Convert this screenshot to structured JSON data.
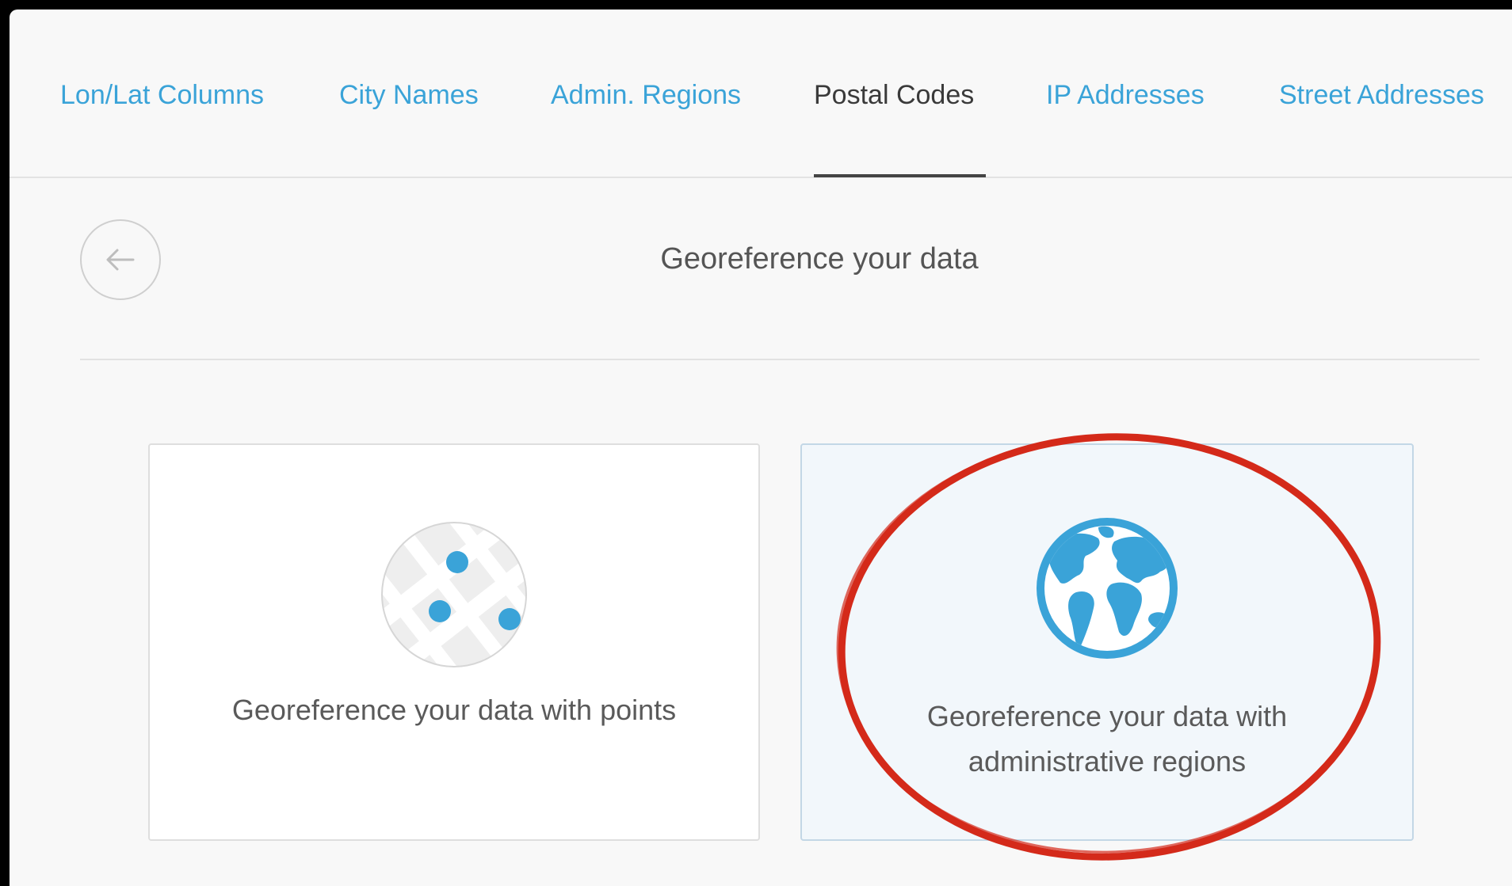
{
  "tabs": [
    {
      "label": "Lon/Lat Columns",
      "active": false
    },
    {
      "label": "City Names",
      "active": false
    },
    {
      "label": "Admin. Regions",
      "active": false
    },
    {
      "label": "Postal Codes",
      "active": true
    },
    {
      "label": "IP Addresses",
      "active": false
    },
    {
      "label": "Street Addresses",
      "active": false
    }
  ],
  "header": {
    "title": "Georeference your data",
    "back_icon": "arrow-left-icon"
  },
  "options": [
    {
      "label": "Georeference your data with points",
      "icon": "map-points-icon",
      "selected": false
    },
    {
      "label": "Georeference your data with administrative regions",
      "icon": "globe-icon",
      "selected": true
    }
  ],
  "colors": {
    "accent": "#3aa3d8",
    "annotation": "#d42a1a",
    "background": "#f8f8f8"
  }
}
